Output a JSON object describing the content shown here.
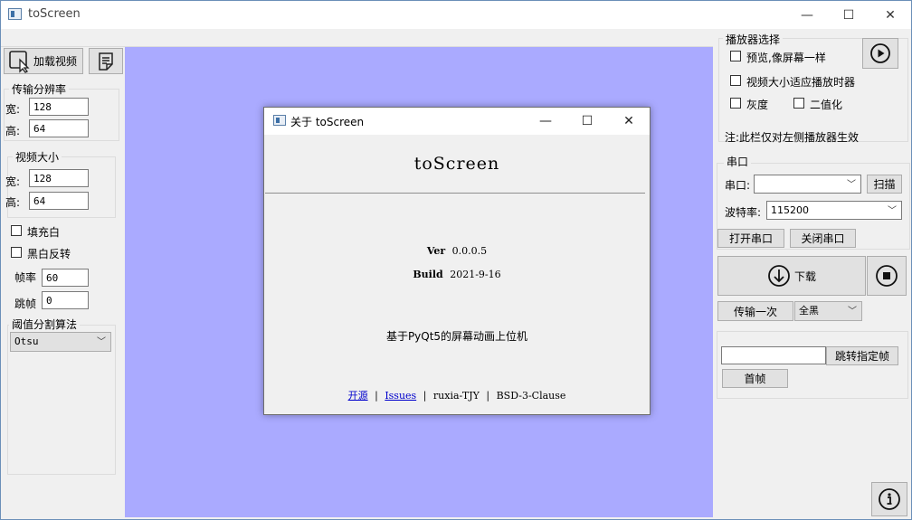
{
  "window": {
    "title": "toScreen",
    "minimize": "—",
    "maximize": "☐",
    "close": "✕"
  },
  "left": {
    "load_video": "加载视频",
    "resolution": {
      "title": "传输分辨率",
      "width_label": "宽:",
      "width": "128",
      "height_label": "高:",
      "height": "64"
    },
    "video_size": {
      "title": "视频大小",
      "width_label": "宽:",
      "width": "128",
      "height_label": "高:",
      "height": "64"
    },
    "fill_white": "填充白",
    "invert": "黑白反转",
    "fps_label": "帧率",
    "fps": "60",
    "skip_label": "跳帧",
    "skip": "0",
    "threshold": {
      "title": "阈值分割算法",
      "value": "Otsu"
    }
  },
  "dialog": {
    "title": "关于 toScreen",
    "app_name": "toScreen",
    "ver_label": "Ver",
    "ver": "0.0.0.5",
    "build_label": "Build",
    "build": "2021-9-16",
    "desc": "基于PyQt5的屏幕动画上位机",
    "link_open": "开源",
    "link_issues": "Issues",
    "author": "ruxia-TJY",
    "license": "BSD-3-Clause",
    "pipe": "|"
  },
  "right": {
    "player": {
      "title": "播放器选择",
      "preview": "预览,像屏幕一样",
      "fit_timer": "视频大小适应播放时器",
      "gray": "灰度",
      "binarize": "二值化",
      "note": "注:此栏仅对左侧播放器生效"
    },
    "serial": {
      "title": "串口",
      "port_label": "串口:",
      "port": "",
      "scan": "扫描",
      "baud_label": "波特率:",
      "baud": "115200",
      "open": "打开串口",
      "close": "关闭串口"
    },
    "download": "下载",
    "transfer_once": "传输一次",
    "fill_mode": "全黑",
    "jump_input": "",
    "jump_frame": "跳转指定帧",
    "first_frame": "首帧"
  },
  "colors": {
    "canvas": "#aaaaff",
    "link": "#0000cc"
  }
}
